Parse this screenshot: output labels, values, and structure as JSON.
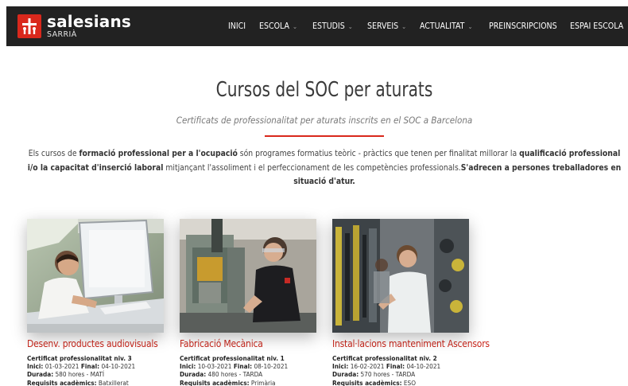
{
  "brand": {
    "name": "salesians",
    "sub": "SARRIÀ"
  },
  "nav": {
    "items": [
      {
        "label": "INICI",
        "dropdown": false
      },
      {
        "label": "ESCOLA",
        "dropdown": true
      },
      {
        "label": "ESTUDIS",
        "dropdown": true
      },
      {
        "label": "SERVEIS",
        "dropdown": true
      },
      {
        "label": "ACTUALITAT",
        "dropdown": true
      },
      {
        "label": "PREINSCRIPCIONS",
        "dropdown": false
      },
      {
        "label": "ESPAI ESCOLA",
        "dropdown": false
      }
    ],
    "chevron": "⌄"
  },
  "page": {
    "title": "Cursos del SOC per aturats",
    "subtitle": "Certificats de professionalitat per aturats inscrits en el SOC a Barcelona",
    "intro": {
      "t1": "Els cursos de ",
      "b1": "formació professional per a l'ocupació",
      "t2": " són programes formatius teòric - pràctics que tenen per finalitat millorar la ",
      "b2": "qualificació professional i/o la capacitat d'inserció laboral",
      "t3": " mitjançant l'assoliment i el perfeccionament de les competències professionals.",
      "b3": "S'adrecen a persones treballadores en situació d'atur."
    }
  },
  "labels": {
    "inici": "Inici:",
    "final": "Final:",
    "durada": "Durada:",
    "requisits": "Requisits acadèmics:"
  },
  "courses": [
    {
      "title": "Desenv. productes audiovisuals",
      "cert": "Certificat professionalitat niv. 3",
      "start": "01-03-2021",
      "end": "04-10-2021",
      "duration": "580 hores - MATÍ",
      "requirements": "Batxillerat"
    },
    {
      "title": "Fabricació Mecànica",
      "cert": "Certificat professionalitat niv. 1",
      "start": "10-03-2021",
      "end": "08-10-2021",
      "duration": "480 hores - TARDA",
      "requirements": "Primària"
    },
    {
      "title": "Instal·lacions manteniment Ascensors",
      "cert": "Certificat professionalitat niv. 2",
      "start": "16-02-2021",
      "end": "04-10-2021",
      "duration": "570 hores - TARDA",
      "requirements": "ESO"
    }
  ],
  "colors": {
    "accent": "#d9281c",
    "nav_bg": "#222222"
  }
}
